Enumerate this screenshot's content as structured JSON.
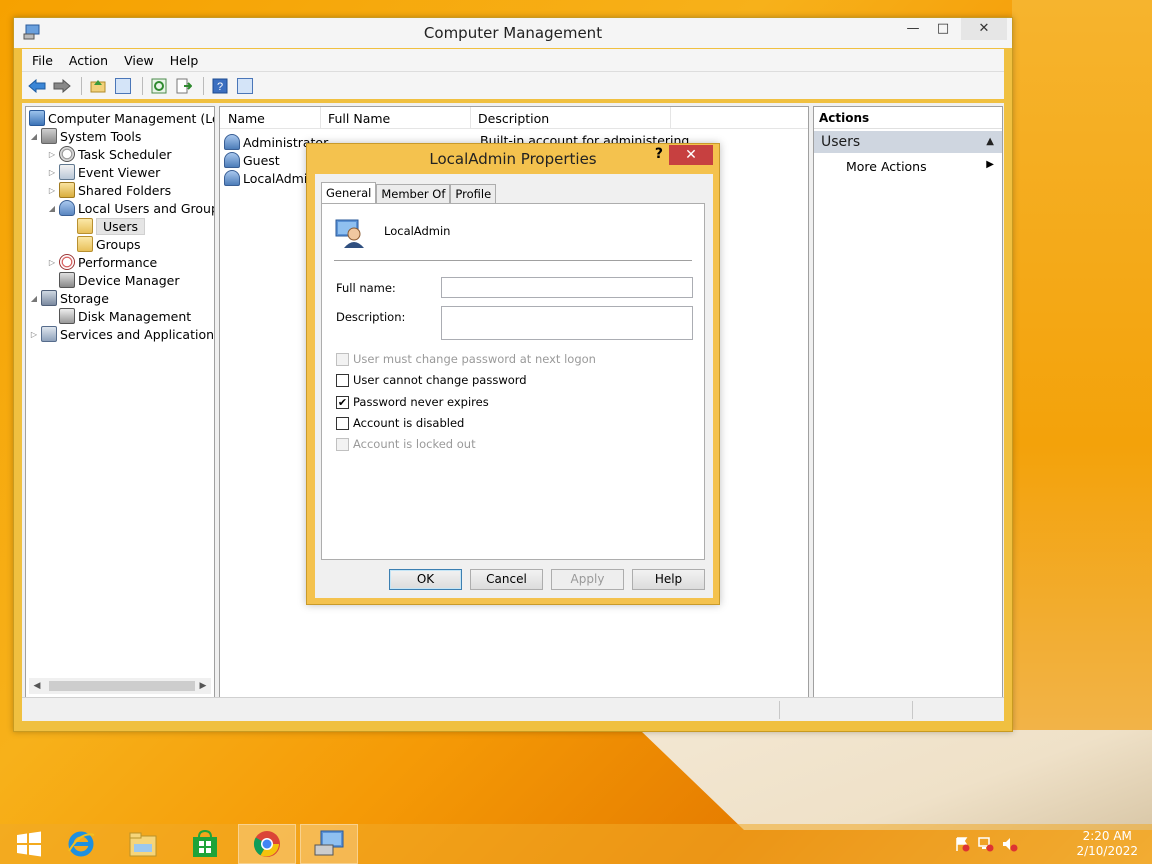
{
  "window": {
    "title": "Computer Management",
    "menu": [
      "File",
      "Action",
      "View",
      "Help"
    ]
  },
  "toolbar_icons": [
    "back-icon",
    "forward-icon",
    "up-folder-icon",
    "show-hide-tree-icon",
    "refresh-icon",
    "export-list-icon",
    "help-icon",
    "show-hide-action-pane-icon"
  ],
  "tree": [
    {
      "label": "Computer Management (Local)",
      "icon": "computer-icon",
      "level": 0,
      "arrow": ""
    },
    {
      "label": "System Tools",
      "icon": "tools-icon",
      "level": 1,
      "arrow": "◢"
    },
    {
      "label": "Task Scheduler",
      "icon": "clock-icon",
      "level": 2,
      "arrow": "▷"
    },
    {
      "label": "Event Viewer",
      "icon": "event-viewer-icon",
      "level": 2,
      "arrow": "▷"
    },
    {
      "label": "Shared Folders",
      "icon": "shared-folder-icon",
      "level": 2,
      "arrow": "▷"
    },
    {
      "label": "Local Users and Groups",
      "icon": "users-group-icon",
      "level": 2,
      "arrow": "◢"
    },
    {
      "label": "Users",
      "icon": "folder-icon",
      "level": 3,
      "arrow": ""
    },
    {
      "label": "Groups",
      "icon": "folder-icon",
      "level": 3,
      "arrow": ""
    },
    {
      "label": "Performance",
      "icon": "performance-icon",
      "level": 2,
      "arrow": "▷"
    },
    {
      "label": "Device Manager",
      "icon": "device-manager-icon",
      "level": 2,
      "arrow": ""
    },
    {
      "label": "Storage",
      "icon": "storage-icon",
      "level": 1,
      "arrow": "◢"
    },
    {
      "label": "Disk Management",
      "icon": "disk-icon",
      "level": 2,
      "arrow": ""
    },
    {
      "label": "Services and Applications",
      "icon": "services-icon",
      "level": 1,
      "arrow": "▷"
    }
  ],
  "list": {
    "columns": [
      "Name",
      "Full Name",
      "Description"
    ],
    "rows": [
      {
        "name": "Administrator",
        "full_name": "",
        "description": "Built-in account for administering..."
      },
      {
        "name": "Guest",
        "full_name": "",
        "description": ""
      },
      {
        "name": "LocalAdmin",
        "full_name": "",
        "description": ""
      }
    ]
  },
  "actions": {
    "header": "Actions",
    "section": "Users",
    "item": "More Actions"
  },
  "dialog": {
    "title": "LocalAdmin Properties",
    "help": "?",
    "close": "✕",
    "tabs": [
      "General",
      "Member Of",
      "Profile"
    ],
    "username": "LocalAdmin",
    "full_name_label": "Full name:",
    "full_name_value": "",
    "description_label": "Description:",
    "description_value": "",
    "checkboxes": [
      {
        "label": "User must change password at next logon",
        "checked": false,
        "disabled": true
      },
      {
        "label": "User cannot change password",
        "checked": false,
        "disabled": false
      },
      {
        "label": "Password never expires",
        "checked": true,
        "disabled": false
      },
      {
        "label": "Account is disabled",
        "checked": false,
        "disabled": false
      },
      {
        "label": "Account is locked out",
        "checked": false,
        "disabled": true
      }
    ],
    "buttons": {
      "ok": "OK",
      "cancel": "Cancel",
      "apply": "Apply",
      "help": "Help"
    }
  },
  "taskbar": {
    "apps": [
      "start-icon",
      "internet-explorer-icon",
      "file-explorer-icon",
      "store-icon",
      "chrome-icon",
      "computer-management-icon"
    ],
    "time": "2:20 AM",
    "date": "2/10/2022"
  },
  "colors": {
    "accent": "#f4c24e",
    "close_red": "#c74040",
    "desktop": "#f6a100"
  }
}
